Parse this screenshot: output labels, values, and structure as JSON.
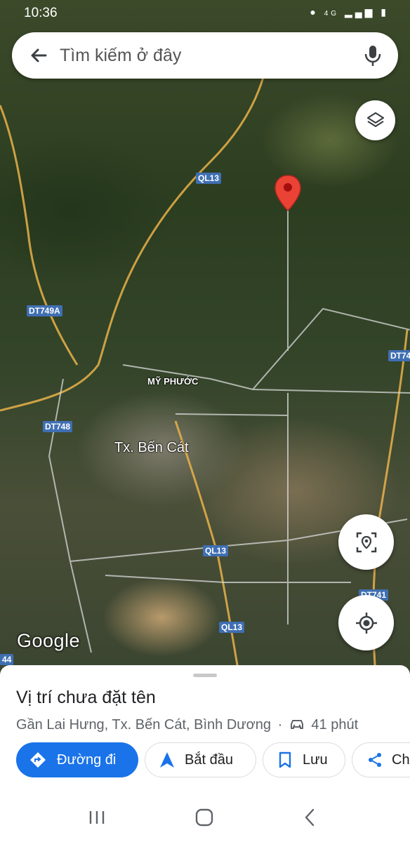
{
  "status_bar": {
    "time": "10:36",
    "network": "4G"
  },
  "search": {
    "placeholder": "Tìm kiếm ở đây"
  },
  "map": {
    "road_labels": [
      "QL13",
      "DT749A",
      "DT748",
      "QL13",
      "QL13",
      "DT74",
      "DT741",
      "44"
    ],
    "places": {
      "ward": "MỸ PHƯỚC",
      "town": "Tx. Bến Cát"
    },
    "attribution": "Google"
  },
  "place": {
    "title": "Vị trí chưa đặt tên",
    "address": "Gần Lai Hưng, Tx. Bến Cát, Bình Dương",
    "separator": "·",
    "drive_time": "41 phút"
  },
  "actions": {
    "directions": "Đường đi",
    "start": "Bắt đầu",
    "save": "Lưu",
    "share": "Ch"
  },
  "colors": {
    "accent": "#1a73e8",
    "pin": "#ea4335",
    "road_shield": "#3f6fb3"
  }
}
